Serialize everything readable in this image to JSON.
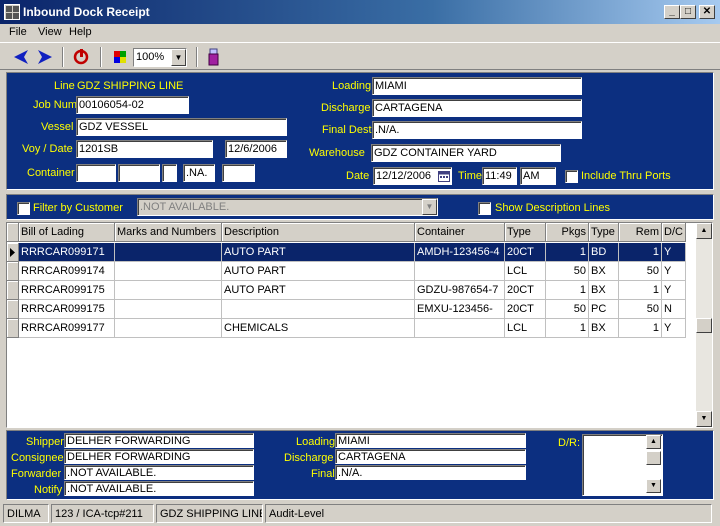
{
  "window": {
    "title": "Inbound Dock Receipt"
  },
  "menu": {
    "file": "File",
    "view": "View",
    "help": "Help"
  },
  "toolbar": {
    "zoom": "100%"
  },
  "header": {
    "line_label": "Line",
    "line_value": "GDZ SHIPPING LINE",
    "job_label": "Job Num",
    "job_value": "00106054-02",
    "vessel_label": "Vessel",
    "vessel_value": "GDZ VESSEL",
    "voy_label": "Voy / Date",
    "voy_value": "1201SB",
    "voy_date": "12/6/2006",
    "container_label": "Container",
    "container_na": ".NA.",
    "loading_label": "Loading",
    "loading_value": "MIAMI",
    "discharge_label": "Discharge",
    "discharge_value": "CARTAGENA",
    "finaldest_label": "Final Dest",
    "finaldest_value": ".N/A.",
    "warehouse_label": "Warehouse",
    "warehouse_value": "GDZ CONTAINER YARD",
    "date_label": "Date",
    "date_value": "12/12/2006",
    "time_label": "Time",
    "time_value": "11:49",
    "ampm_value": "AM",
    "thru_ports_label": "Include Thru Ports"
  },
  "filter": {
    "filter_label": "Filter by Customer",
    "customer_value": ".NOT AVAILABLE.",
    "show_desc_label": "Show Description Lines"
  },
  "grid": {
    "columns": [
      "Bill of Lading",
      "Marks and Numbers",
      "Description",
      "Container",
      "Type",
      "Pkgs",
      "Type",
      "Rem",
      "D/C"
    ],
    "rows": [
      [
        "RRRCAR099171",
        "",
        "AUTO PART",
        "AMDH-123456-4",
        "20CT",
        "1",
        "BD",
        "1",
        "Y"
      ],
      [
        "RRRCAR099174",
        "",
        "AUTO PART",
        "",
        "LCL",
        "50",
        "BX",
        "50",
        "Y"
      ],
      [
        "RRRCAR099175",
        "",
        "AUTO PART",
        "GDZU-987654-7",
        "20CT",
        "1",
        "BX",
        "1",
        "Y"
      ],
      [
        "RRRCAR099175",
        "",
        "",
        "EMXU-123456-",
        "20CT",
        "50",
        "PC",
        "50",
        "N"
      ],
      [
        "RRRCAR099177",
        "",
        "CHEMICALS",
        "",
        "LCL",
        "1",
        "BX",
        "1",
        "Y"
      ]
    ]
  },
  "detail": {
    "shipper_label": "Shipper",
    "shipper_value": "DELHER FORWARDING",
    "consignee_label": "Consignee",
    "consignee_value": "DELHER FORWARDING",
    "forwarder_label": "Forwarder",
    "forwarder_value": ".NOT AVAILABLE.",
    "notify_label": "Notify",
    "notify_value": ".NOT AVAILABLE.",
    "loading_label": "Loading",
    "loading_value": "MIAMI",
    "discharge_label": "Discharge",
    "discharge_value": "CARTAGENA",
    "final_label": "Final",
    "final_value": ".N/A.",
    "dr_label": "D/R:"
  },
  "status": {
    "user": "DILMA",
    "connection": "123 / ICA-tcp#211",
    "line": "GDZ SHIPPING LINE",
    "level": "Audit-Level"
  },
  "colors": {
    "panel": "#0c2f80",
    "label": "#ffff00",
    "selection": "#0a246a"
  },
  "icons": [
    "back-arrow-icon",
    "forward-arrow-icon",
    "refresh-icon",
    "color-palette-icon",
    "print-icon"
  ]
}
